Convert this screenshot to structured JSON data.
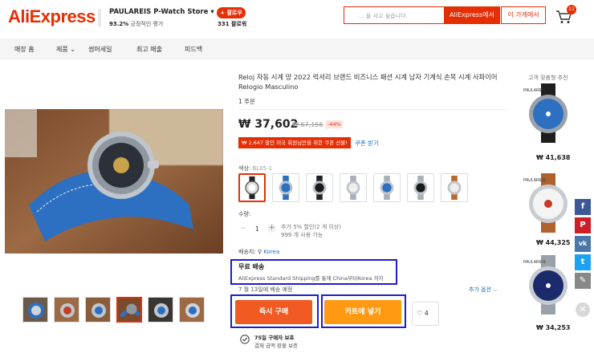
{
  "brand": {
    "logo_text": "AliExpress",
    "color": "#e62e04"
  },
  "store": {
    "name": "PAULAREIS P-Watch Store",
    "chevron": "▾",
    "rating_value": "93.2%",
    "rating_label": "긍정적인 평가",
    "follow_label": "+ 팔로우",
    "followers": "331 팔로워"
  },
  "search": {
    "placeholder": "... 을 사고 싶습니다.",
    "btn_aliexpress": "AliExpress에서",
    "btn_store": "이 가게에서"
  },
  "cart": {
    "badge": "11",
    "icon": "shopping-cart-icon"
  },
  "nav": {
    "items": [
      "매장 홈",
      "제품",
      "썸머세일",
      "최고 매출",
      "피드백"
    ]
  },
  "product": {
    "title": "Reloj 자동 시계 망 2022 럭셔리 브랜드 비즈니스 패션 시계 남자 기계식 손목 시계 사파이어 Relogio Masculino",
    "orders": "1 주문",
    "price": "₩ 37,602",
    "price_old": "₩ 67,156",
    "discount": "-44%",
    "coupon_text": "₩ 2,647 할인 미국 회원님만을 위한 쿠폰 선물!",
    "coupon_link": "쿠폰 받기",
    "color_label": "색상:",
    "color_value": "BL05-1",
    "qty_label": "수량:",
    "qty_value": "1",
    "qty_minus": "−",
    "qty_plus": "+",
    "qty_info1": "추가 5% 할인(2 개 이상)",
    "qty_info2": "999 개 사용 가능",
    "ship_label": "배송지:",
    "ship_value": "Korea",
    "free_shipping_title": "무료 배송",
    "free_shipping_desc": "AliExpress Standard Shipping를 통해 China부터Korea 까지",
    "delivery": "7 월 13일에 배송 예정",
    "more_options": "추가 옵션 ⌵",
    "buy_now": "즉시 구매",
    "add_to_cart": "카트에 넣기",
    "wishlist_count": "4",
    "guarantee1": "75일 구매자 보호",
    "guarantee2": "결제 금액 환불 보증"
  },
  "recommend": {
    "title": "고객 맞춤형 추천",
    "items": [
      {
        "price": "₩ 41,638"
      },
      {
        "price": "₩ 44,325"
      },
      {
        "price": "₩ 34,253"
      }
    ]
  },
  "social": [
    {
      "icon": "facebook-icon",
      "glyph": "f",
      "color": "#3b5998"
    },
    {
      "icon": "pinterest-icon",
      "glyph": "P",
      "color": "#cb2027"
    },
    {
      "icon": "vk-icon",
      "glyph": "vk",
      "color": "#4a76a8"
    },
    {
      "icon": "twitter-icon",
      "glyph": "t",
      "color": "#1da1f2"
    },
    {
      "icon": "pencil-icon",
      "glyph": "✎",
      "color": "#888888"
    }
  ],
  "close_glyph": "✕"
}
